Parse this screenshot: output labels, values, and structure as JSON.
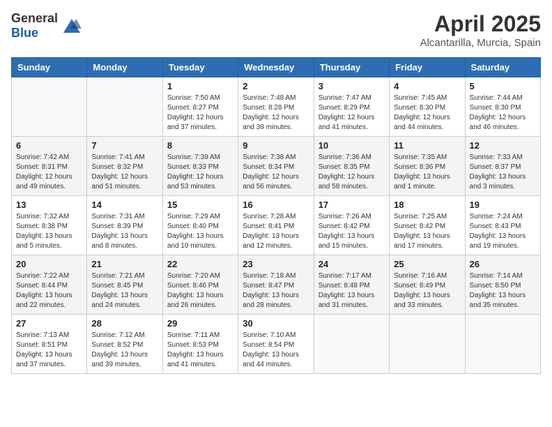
{
  "header": {
    "logo_general": "General",
    "logo_blue": "Blue",
    "month_title": "April 2025",
    "location": "Alcantarilla, Murcia, Spain"
  },
  "weekdays": [
    "Sunday",
    "Monday",
    "Tuesday",
    "Wednesday",
    "Thursday",
    "Friday",
    "Saturday"
  ],
  "weeks": [
    [
      {
        "day": "",
        "info": ""
      },
      {
        "day": "",
        "info": ""
      },
      {
        "day": "1",
        "info": "Sunrise: 7:50 AM\nSunset: 8:27 PM\nDaylight: 12 hours and 37 minutes."
      },
      {
        "day": "2",
        "info": "Sunrise: 7:48 AM\nSunset: 8:28 PM\nDaylight: 12 hours and 39 minutes."
      },
      {
        "day": "3",
        "info": "Sunrise: 7:47 AM\nSunset: 8:29 PM\nDaylight: 12 hours and 41 minutes."
      },
      {
        "day": "4",
        "info": "Sunrise: 7:45 AM\nSunset: 8:30 PM\nDaylight: 12 hours and 44 minutes."
      },
      {
        "day": "5",
        "info": "Sunrise: 7:44 AM\nSunset: 8:30 PM\nDaylight: 12 hours and 46 minutes."
      }
    ],
    [
      {
        "day": "6",
        "info": "Sunrise: 7:42 AM\nSunset: 8:31 PM\nDaylight: 12 hours and 49 minutes."
      },
      {
        "day": "7",
        "info": "Sunrise: 7:41 AM\nSunset: 8:32 PM\nDaylight: 12 hours and 51 minutes."
      },
      {
        "day": "8",
        "info": "Sunrise: 7:39 AM\nSunset: 8:33 PM\nDaylight: 12 hours and 53 minutes."
      },
      {
        "day": "9",
        "info": "Sunrise: 7:38 AM\nSunset: 8:34 PM\nDaylight: 12 hours and 56 minutes."
      },
      {
        "day": "10",
        "info": "Sunrise: 7:36 AM\nSunset: 8:35 PM\nDaylight: 12 hours and 58 minutes."
      },
      {
        "day": "11",
        "info": "Sunrise: 7:35 AM\nSunset: 8:36 PM\nDaylight: 13 hours and 1 minute."
      },
      {
        "day": "12",
        "info": "Sunrise: 7:33 AM\nSunset: 8:37 PM\nDaylight: 13 hours and 3 minutes."
      }
    ],
    [
      {
        "day": "13",
        "info": "Sunrise: 7:32 AM\nSunset: 8:38 PM\nDaylight: 13 hours and 5 minutes."
      },
      {
        "day": "14",
        "info": "Sunrise: 7:31 AM\nSunset: 8:39 PM\nDaylight: 13 hours and 8 minutes."
      },
      {
        "day": "15",
        "info": "Sunrise: 7:29 AM\nSunset: 8:40 PM\nDaylight: 13 hours and 10 minutes."
      },
      {
        "day": "16",
        "info": "Sunrise: 7:28 AM\nSunset: 8:41 PM\nDaylight: 13 hours and 12 minutes."
      },
      {
        "day": "17",
        "info": "Sunrise: 7:26 AM\nSunset: 8:42 PM\nDaylight: 13 hours and 15 minutes."
      },
      {
        "day": "18",
        "info": "Sunrise: 7:25 AM\nSunset: 8:42 PM\nDaylight: 13 hours and 17 minutes."
      },
      {
        "day": "19",
        "info": "Sunrise: 7:24 AM\nSunset: 8:43 PM\nDaylight: 13 hours and 19 minutes."
      }
    ],
    [
      {
        "day": "20",
        "info": "Sunrise: 7:22 AM\nSunset: 8:44 PM\nDaylight: 13 hours and 22 minutes."
      },
      {
        "day": "21",
        "info": "Sunrise: 7:21 AM\nSunset: 8:45 PM\nDaylight: 13 hours and 24 minutes."
      },
      {
        "day": "22",
        "info": "Sunrise: 7:20 AM\nSunset: 8:46 PM\nDaylight: 13 hours and 26 minutes."
      },
      {
        "day": "23",
        "info": "Sunrise: 7:18 AM\nSunset: 8:47 PM\nDaylight: 13 hours and 28 minutes."
      },
      {
        "day": "24",
        "info": "Sunrise: 7:17 AM\nSunset: 8:48 PM\nDaylight: 13 hours and 31 minutes."
      },
      {
        "day": "25",
        "info": "Sunrise: 7:16 AM\nSunset: 8:49 PM\nDaylight: 13 hours and 33 minutes."
      },
      {
        "day": "26",
        "info": "Sunrise: 7:14 AM\nSunset: 8:50 PM\nDaylight: 13 hours and 35 minutes."
      }
    ],
    [
      {
        "day": "27",
        "info": "Sunrise: 7:13 AM\nSunset: 8:51 PM\nDaylight: 13 hours and 37 minutes."
      },
      {
        "day": "28",
        "info": "Sunrise: 7:12 AM\nSunset: 8:52 PM\nDaylight: 13 hours and 39 minutes."
      },
      {
        "day": "29",
        "info": "Sunrise: 7:11 AM\nSunset: 8:53 PM\nDaylight: 13 hours and 41 minutes."
      },
      {
        "day": "30",
        "info": "Sunrise: 7:10 AM\nSunset: 8:54 PM\nDaylight: 13 hours and 44 minutes."
      },
      {
        "day": "",
        "info": ""
      },
      {
        "day": "",
        "info": ""
      },
      {
        "day": "",
        "info": ""
      }
    ]
  ]
}
